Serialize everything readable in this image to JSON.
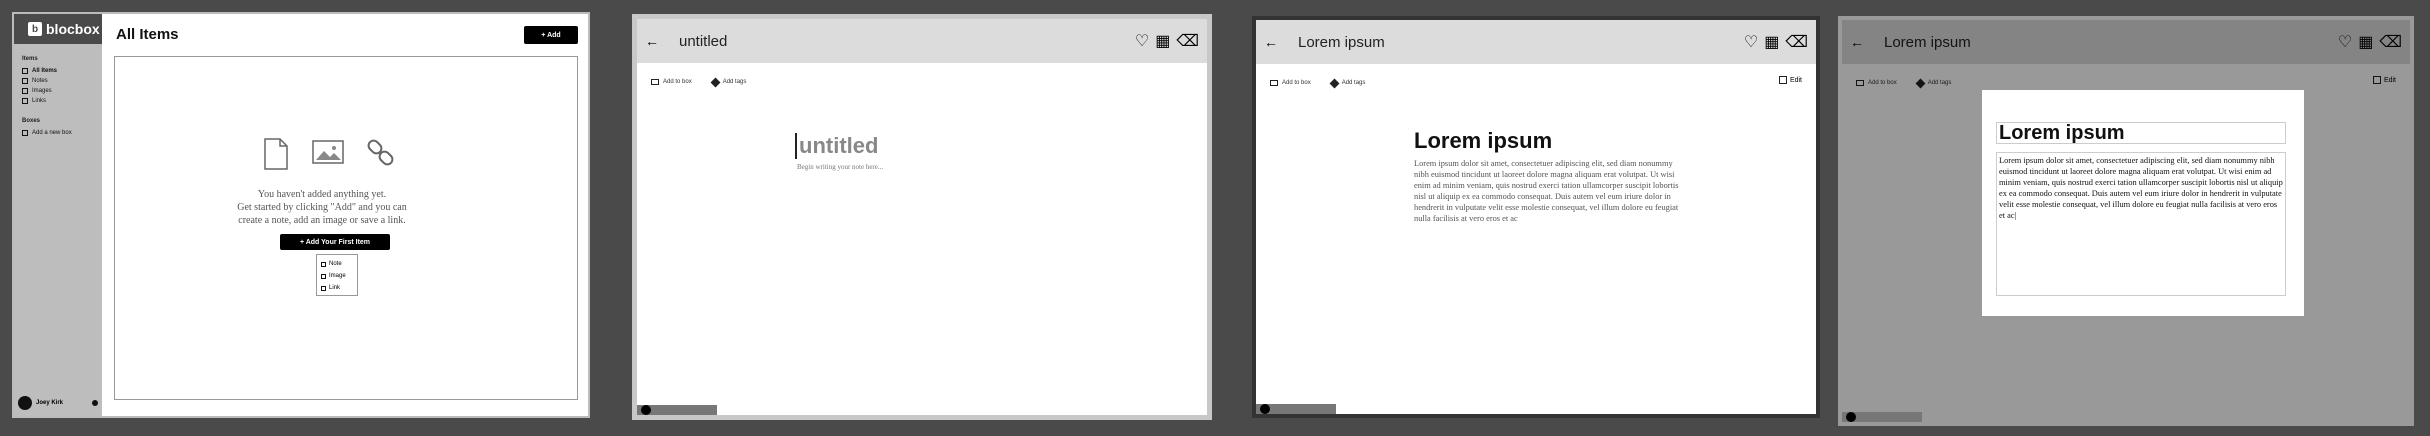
{
  "frame1": {
    "brand": "blocbox",
    "items_section": "Items",
    "nav": [
      {
        "label": "All Items"
      },
      {
        "label": "Notes"
      },
      {
        "label": "Images"
      },
      {
        "label": "Links"
      }
    ],
    "boxes_section": "Boxes",
    "add_box": "Add a new box",
    "user": "Joey Kirk",
    "page_title": "All Items",
    "add_button": "+ Add",
    "empty_line1": "You haven't added anything yet.",
    "empty_line2": "Get started by clicking \"Add\" and you can",
    "empty_line3": "create a note, add an image or save a link.",
    "first_item_button": "+ Add Your First Item",
    "dropdown": [
      "Note",
      "Image",
      "Link"
    ]
  },
  "frame2": {
    "title": "untitled",
    "add_to_box": "Add to box",
    "add_tags": "Add tags",
    "note_title": "untitled",
    "hint": "Begin writing your note here..."
  },
  "frame3": {
    "title": "Lorem ipsum",
    "add_to_box": "Add to box",
    "add_tags": "Add tags",
    "edit": "Edit",
    "note_title": "Lorem ipsum",
    "body": "Lorem ipsum dolor sit amet, consectetuer adipiscing elit, sed diam nonummy nibh euismod tincidunt ut laoreet dolore magna aliquam erat volutpat. Ut wisi enim ad minim veniam, quis nostrud exerci tation ullamcorper suscipit lobortis nisl ut aliquip ex ea commodo consequat. Duis autem vel eum iriure dolor in hendrerit in vulputate velit esse molestie consequat, vel illum dolore eu feugiat nulla facilisis at vero eros et ac"
  },
  "frame4": {
    "title": "Lorem ipsum",
    "add_to_box": "Add to box",
    "add_tags": "Add tags",
    "edit": "Edit",
    "note_title": "Lorem ipsum",
    "body": "Lorem ipsum dolor sit amet, consectetuer adipiscing elit, sed diam nonummy nibh euismod tincidunt ut laoreet dolore magna aliquam erat volutpat. Ut wisi enim ad minim veniam, quis nostrud exerci tation ullamcorper suscipit lobortis nisl ut aliquip ex ea commodo consequat. Duis autem vel eum iriure dolor in hendrerit in vulputate velit esse molestie consequat, vel illum dolore eu feugiat nulla facilisis at vero eros et ac|"
  }
}
